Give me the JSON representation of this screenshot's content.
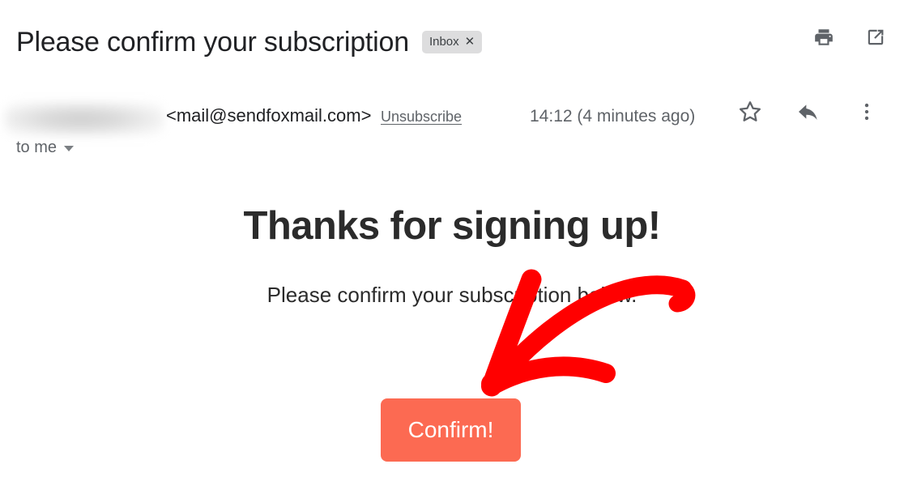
{
  "email_header": {
    "subject": "Please confirm your subscription",
    "label_chip": {
      "name": "Inbox",
      "close_glyph": "✕"
    },
    "actions": [
      {
        "name": "print-icon",
        "title": "Print all"
      },
      {
        "name": "open-in-new-icon",
        "title": "In new window"
      }
    ]
  },
  "sender": {
    "display_name_redacted": "",
    "email": "<mail@sendfoxmail.com>",
    "unsubscribe_label": "Unsubscribe",
    "timestamp": "14:12 (4 minutes ago)",
    "recipient_label": "to me",
    "actions": [
      {
        "name": "star-icon",
        "title": "Not starred"
      },
      {
        "name": "reply-icon",
        "title": "Reply"
      },
      {
        "name": "more-icon",
        "title": "More"
      }
    ]
  },
  "message_body": {
    "heading": "Thanks for signing up!",
    "paragraph": "Please confirm your subscription below.",
    "confirm_button_label": "Confirm!"
  },
  "colors": {
    "confirm_button_bg": "#FC6A52",
    "confirm_button_text": "#FFFFFF",
    "annotation_arrow": "#FF0000",
    "chip_bg": "#DDDDDE",
    "subject_text": "#202124",
    "muted_text": "#5F6368",
    "body_text": "#2B2B2B"
  },
  "annotation": {
    "name": "red-arrow-pointing-to-confirm-button",
    "color": "#FF0000"
  }
}
